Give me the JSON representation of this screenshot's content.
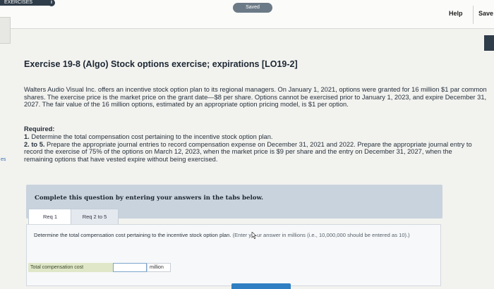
{
  "topbar": {
    "exercises_tab": "EXERCISES",
    "exercises_badge": "i",
    "saved_label": "Saved",
    "help_label": "Help",
    "save_label": "Save"
  },
  "gutter": {
    "label": "es"
  },
  "exercise": {
    "title": "Exercise 19-8 (Algo) Stock options exercise; expirations [LO19-2]",
    "description": "Walters Audio Visual Inc. offers an incentive stock option plan to its regional managers. On January 1, 2021, options were granted for 16 million $1 par common shares. The exercise price is the market price on the grant date—$8 per share. Options cannot be exercised prior to January 1, 2023, and expire December 31, 2027. The fair value of the 16 million options, estimated by an appropriate option pricing model, is $1 per option.",
    "required_heading": "Required:",
    "requirements": [
      {
        "num": "1.",
        "text": "Determine the total compensation cost pertaining to the incentive stock option plan."
      },
      {
        "num": "2. to 5.",
        "text": "Prepare the appropriate journal entries to record compensation expense on December 31, 2021 and 2022. Prepare the appropriate journal entry to record the exercise of 75% of the options on March 12, 2023, when the market price is $9 per share and the entry on December 31, 2027, when the remaining options that have vested expire without being exercised."
      }
    ]
  },
  "instructions": "Complete this question by entering your answers in the tabs below.",
  "tabs": [
    {
      "label": "Req 1"
    },
    {
      "label": "Req 2 to 5"
    }
  ],
  "question": {
    "text": "Determine the total compensation cost pertaining to the incentive stock option plan.",
    "hint_before": "(Enter y",
    "hint_after": "ur answer in millions (i.e., 10,000,000 should be entered as 10).)",
    "row_label": "Total compensation cost",
    "answer_value": "",
    "unit": "million"
  }
}
